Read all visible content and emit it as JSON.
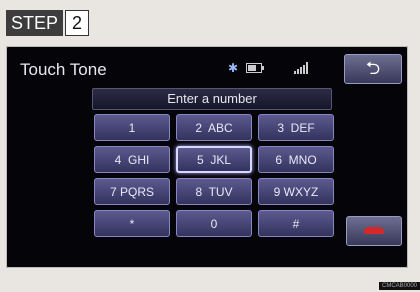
{
  "step": {
    "label": "STEP",
    "number": "2"
  },
  "screen": {
    "title": "Touch Tone",
    "back_label": "⮌",
    "entry_placeholder": "Enter a number",
    "keys": [
      {
        "text": "1"
      },
      {
        "text": "2  ABC"
      },
      {
        "text": "3  DEF"
      },
      {
        "text": "4  GHI"
      },
      {
        "text": "5  JKL"
      },
      {
        "text": "6  MNO"
      },
      {
        "text": "7 PQRS"
      },
      {
        "text": "8  TUV"
      },
      {
        "text": "9 WXYZ"
      },
      {
        "text": "*"
      },
      {
        "text": "0"
      },
      {
        "text": "#"
      }
    ],
    "selected_key": "5  JKL",
    "icons": {
      "bluetooth": "bluetooth-icon",
      "battery": "battery-icon",
      "signal": "signal-icon",
      "back": "back-arrow-icon",
      "hangup": "hangup-icon"
    }
  },
  "colors": {
    "key_bg": "#4a4880",
    "hangup": "#d62828",
    "screen_bg": "#050509"
  },
  "image_code": "CMCAB0000"
}
